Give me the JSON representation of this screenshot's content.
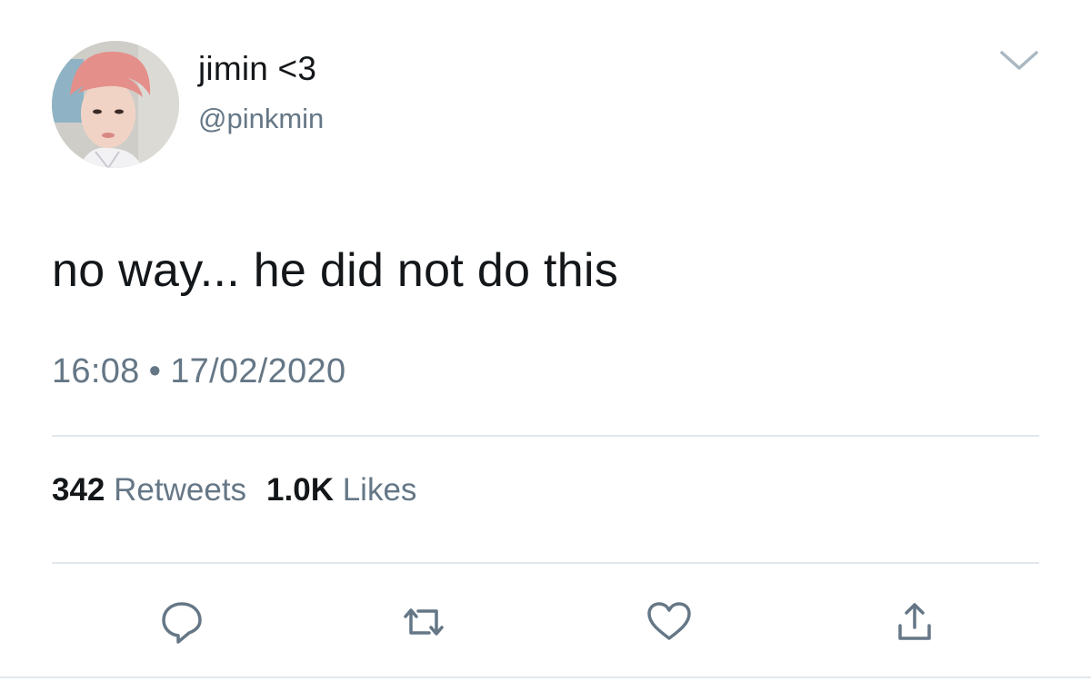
{
  "user": {
    "display_name": "jimin <3",
    "handle": "@pinkmin"
  },
  "tweet": {
    "text": "no way... he did not do this",
    "time": "16:08",
    "separator": "•",
    "date": "17/02/2020"
  },
  "stats": {
    "retweets_count": "342",
    "retweets_label": "Retweets",
    "likes_count": "1.0K",
    "likes_label": "Likes"
  },
  "icons": {
    "menu": "chevron-down-icon",
    "reply": "reply-icon",
    "retweet": "retweet-icon",
    "like": "heart-icon",
    "share": "share-icon"
  },
  "colors": {
    "text_primary": "#14171a",
    "text_secondary": "#657786",
    "icon": "#657786",
    "divider": "#e1e8ed"
  }
}
